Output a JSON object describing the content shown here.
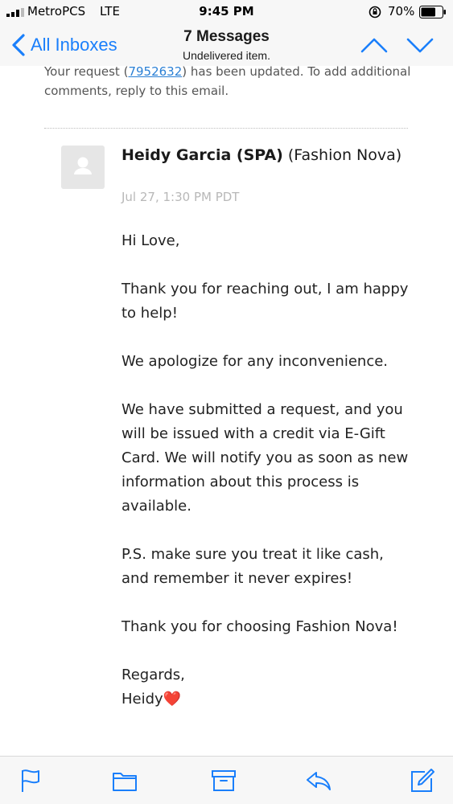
{
  "status_bar": {
    "carrier": "MetroPCS",
    "network": "LTE",
    "time": "9:45 PM",
    "battery": "70%",
    "battery_level": 0.7
  },
  "nav": {
    "back_label": "All Inboxes",
    "title": "7 Messages",
    "subtitle": "Undelivered item."
  },
  "previous_message": {
    "text_before": "Your request (",
    "request_link": "7952632",
    "text_after": ") has been updated. To add additional comments, reply to this email."
  },
  "message": {
    "sender_name": "Heidy Garcia (SPA)",
    "sender_org": "(Fashion Nova)",
    "date": "Jul 27, 1:30 PM PDT",
    "body": {
      "greeting": "Hi Love,",
      "p1": "Thank you for reaching out, I am happy to help!",
      "p2": "We apologize for any inconvenience.",
      "p3": "We have submitted a request, and you will be issued with a credit via E-Gift Card. We will notify you as soon as new information about this process is available.",
      "p4": "P.S. make sure you treat it like cash, and remember it never expires!",
      "p5": "Thank you for choosing Fashion Nova!",
      "closing": "Regards,",
      "signature": "Heidy",
      "signature_emoji": "❤️"
    }
  },
  "toolbar": {
    "icons": [
      "flag-icon",
      "folder-icon",
      "archive-icon",
      "reply-icon",
      "compose-icon"
    ]
  },
  "colors": {
    "accent": "#1a7ffb",
    "link": "#2a7fd4",
    "heart": "#d7263d"
  }
}
